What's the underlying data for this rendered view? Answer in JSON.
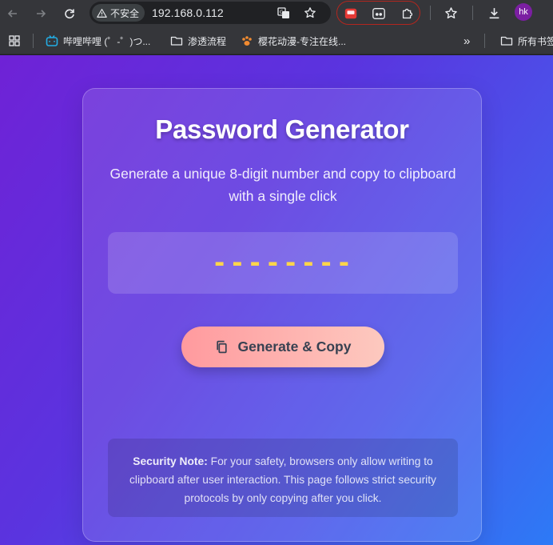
{
  "browser": {
    "security_label": "不安全",
    "url": "192.168.0.112",
    "avatar_initials": "hk",
    "icons": {
      "back": "arrow-left-icon",
      "forward": "arrow-right-icon",
      "reload": "reload-icon",
      "warning": "warning-triangle-icon",
      "translate": "translate-icon",
      "bookmark_star": "star-icon",
      "extensions": "puzzle-icon",
      "download": "download-icon"
    }
  },
  "bookmarks": {
    "items": [
      {
        "label": "哔哩哔哩 (゜-゜)つ...",
        "icon": "bilibili-icon"
      },
      {
        "label": "渗透流程",
        "icon": "folder-icon"
      },
      {
        "label": "樱花动漫-专注在线...",
        "icon": "paw-icon"
      }
    ],
    "overflow_label": "»",
    "all_bookmarks_label": "所有书签"
  },
  "page": {
    "title": "Password Generator",
    "subtitle": "Generate a unique 8-digit number and copy to clipboard with a single click",
    "password_display": "--------",
    "generate_button_label": "Generate & Copy",
    "note_bold": "Security Note:",
    "note_text": " For your safety, browsers only allow writing to clipboard after user interaction. This page follows strict security protocols by only copying after you click.",
    "colors": {
      "gradient_start": "#6f22d6",
      "gradient_end": "#2d7af6",
      "password_digits": "#ffd54a",
      "button_start": "#ff9a9e",
      "button_end": "#fdc9bf"
    }
  }
}
